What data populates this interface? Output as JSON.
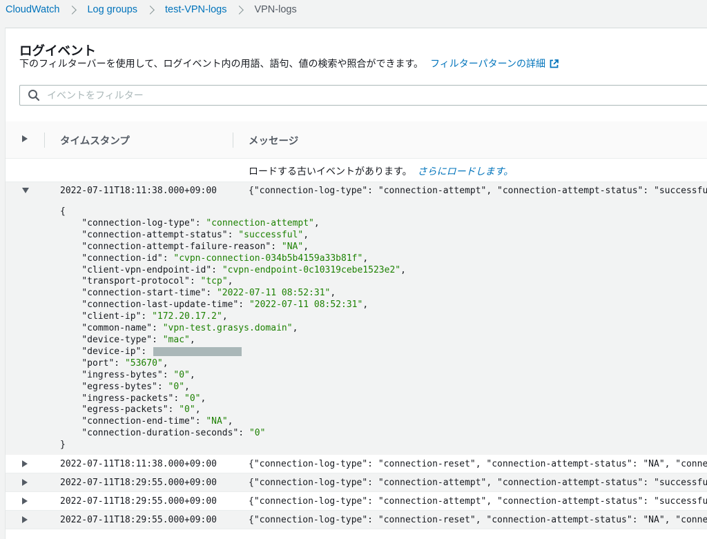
{
  "breadcrumb": [
    {
      "label": "CloudWatch",
      "link": true
    },
    {
      "label": "Log groups",
      "link": true
    },
    {
      "label": "test-VPN-logs",
      "link": true
    },
    {
      "label": "VPN-logs",
      "link": false
    }
  ],
  "page": {
    "title": "ログイベント",
    "description": "下のフィルターバーを使用して、ログイベント内の用語、語句、値の検索や照合ができます。",
    "details_link": "フィルターパターンの詳細",
    "details_link_icon": "external-link-icon"
  },
  "filter": {
    "placeholder": "イベントをフィルター",
    "value": "",
    "icon": "search-icon"
  },
  "table": {
    "col_timestamp": "タイムスタンプ",
    "col_message": "メッセージ",
    "load_more_text": "ロードする古いイベントがあります。",
    "load_more_link": "さらにロードします。"
  },
  "expanded_event": {
    "timestamp": "2022-07-11T18:11:38.000+09:00",
    "message": "{\"connection-log-type\": \"connection-attempt\", \"connection-attempt-status\": \"successful\",",
    "json_open": "{",
    "json_close": "}",
    "fields": [
      {
        "key": "\"connection-log-type\"",
        "value": "\"connection-attempt\""
      },
      {
        "key": "\"connection-attempt-status\"",
        "value": "\"successful\""
      },
      {
        "key": "\"connection-attempt-failure-reason\"",
        "value": "\"NA\""
      },
      {
        "key": "\"connection-id\"",
        "value": "\"cvpn-connection-034b5b4159a33b81f\""
      },
      {
        "key": "\"client-vpn-endpoint-id\"",
        "value": "\"cvpn-endpoint-0c10319cebe1523e2\""
      },
      {
        "key": "\"transport-protocol\"",
        "value": "\"tcp\""
      },
      {
        "key": "\"connection-start-time\"",
        "value": "\"2022-07-11 08:52:31\""
      },
      {
        "key": "\"connection-last-update-time\"",
        "value": "\"2022-07-11 08:52:31\""
      },
      {
        "key": "\"client-ip\"",
        "value": "\"172.20.17.2\""
      },
      {
        "key": "\"common-name\"",
        "value": "\"vpn-test.grasys.domain\""
      },
      {
        "key": "\"device-type\"",
        "value": "\"mac\""
      },
      {
        "key": "\"device-ip\"",
        "value": ""
      },
      {
        "key": "\"port\"",
        "value": "\"53670\""
      },
      {
        "key": "\"ingress-bytes\"",
        "value": "\"0\""
      },
      {
        "key": "\"egress-bytes\"",
        "value": "\"0\""
      },
      {
        "key": "\"ingress-packets\"",
        "value": "\"0\""
      },
      {
        "key": "\"egress-packets\"",
        "value": "\"0\""
      },
      {
        "key": "\"connection-end-time\"",
        "value": "\"NA\""
      },
      {
        "key": "\"connection-duration-seconds\"",
        "value": "\"0\""
      }
    ]
  },
  "events": [
    {
      "timestamp": "2022-07-11T18:11:38.000+09:00",
      "message": "{\"connection-log-type\": \"connection-reset\", \"connection-attempt-status\": \"NA\", \"connecti"
    },
    {
      "timestamp": "2022-07-11T18:29:55.000+09:00",
      "message": "{\"connection-log-type\": \"connection-attempt\", \"connection-attempt-status\": \"successful\","
    },
    {
      "timestamp": "2022-07-11T18:29:55.000+09:00",
      "message": "{\"connection-log-type\": \"connection-attempt\", \"connection-attempt-status\": \"successful\","
    },
    {
      "timestamp": "2022-07-11T18:29:55.000+09:00",
      "message": "{\"connection-log-type\": \"connection-reset\", \"connection-attempt-status\": \"NA\", \"connecti"
    }
  ],
  "colors": {
    "link": "#0073bb",
    "json_value": "#1d8102",
    "expanded_bg": "#f2f3f3"
  }
}
